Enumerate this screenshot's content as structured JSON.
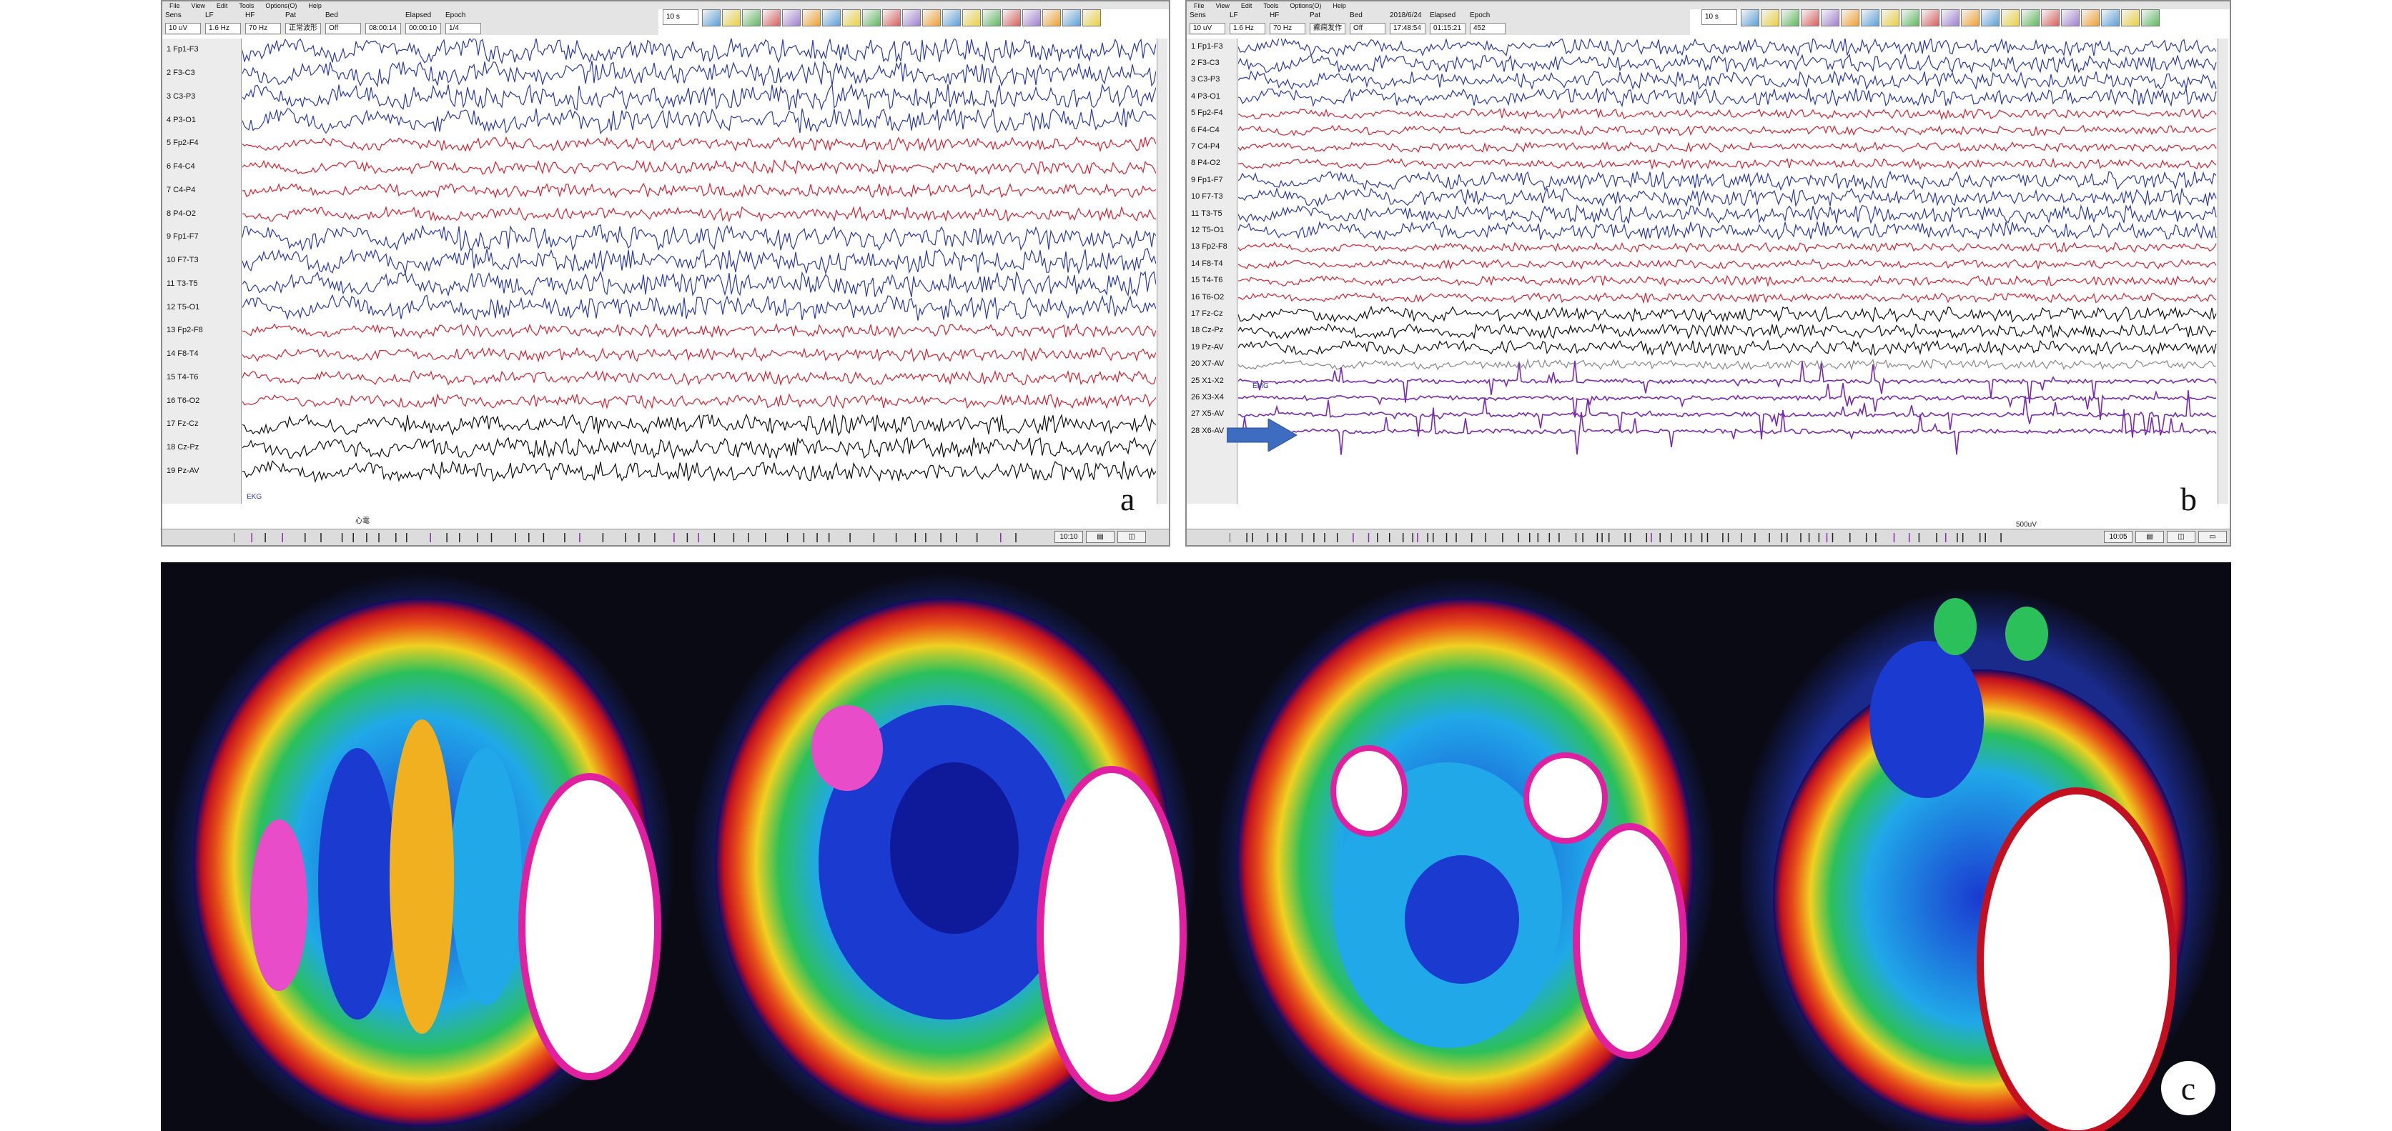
{
  "panel_a": {
    "letter": "a",
    "menu": [
      "File",
      "View",
      "Edit",
      "Tools",
      "Options(O)",
      "Help"
    ],
    "header_labels": [
      "Sens",
      "LF",
      "HF",
      "Pat",
      "Bed",
      "",
      "Elapsed",
      "Epoch"
    ],
    "fields": [
      "10 uV",
      "1.6 Hz",
      "70 Hz",
      "正常波形",
      "Off",
      "08:00:14",
      "00:00:10",
      "1/4"
    ],
    "paging": "10 s",
    "channels": [
      "1 Fp1-F3",
      "2 F3-C3",
      "3 C3-P3",
      "4 P3-O1",
      "5 Fp2-F4",
      "6 F4-C4",
      "7 C4-P4",
      "8 P4-O2",
      "9 Fp1-F7",
      "10 F7-T3",
      "11 T3-T5",
      "12 T5-O1",
      "13 Fp2-F8",
      "14 F8-T4",
      "15 T4-T6",
      "16 T6-O2",
      "17 Fz-Cz",
      "18 Cz-Pz",
      "19 Pz-AV"
    ],
    "channel_colors": [
      "blue",
      "blue",
      "blue",
      "blue",
      "red",
      "red",
      "red",
      "red",
      "blue",
      "blue",
      "blue",
      "blue",
      "red",
      "red",
      "red",
      "red",
      "black",
      "black",
      "black"
    ],
    "bottom_labels": [
      "EKG",
      "心電"
    ],
    "status_buttons": [
      "10:10",
      "▤",
      "◫"
    ]
  },
  "panel_b": {
    "letter": "b",
    "menu": [
      "File",
      "View",
      "Edit",
      "Tools",
      "Options(O)",
      "Help"
    ],
    "header_labels": [
      "Sens",
      "LF",
      "HF",
      "Pat",
      "Bed",
      "2018/6/24",
      "Elapsed",
      "Epoch"
    ],
    "fields": [
      "10 uV",
      "1.6 Hz",
      "70 Hz",
      "癫痫发作",
      "Off",
      "17:48:54",
      "01:15:21",
      "452"
    ],
    "paging": "10 s",
    "channels": [
      "1 Fp1-F3",
      "2 F3-C3",
      "3 C3-P3",
      "4 P3-O1",
      "5 Fp2-F4",
      "6 F4-C4",
      "7 C4-P4",
      "8 P4-O2",
      "9 Fp1-F7",
      "10 F7-T3",
      "11 T3-T5",
      "12 T5-O1",
      "13 Fp2-F8",
      "14 F8-T4",
      "15 T4-T6",
      "16 T6-O2",
      "17 Fz-Cz",
      "18 Cz-Pz",
      "19 Pz-AV",
      "20 X7-AV",
      "25 X1-X2",
      "26 X3-X4",
      "27 X5-AV",
      "28 X6-AV"
    ],
    "channel_colors": [
      "blue",
      "blue",
      "blue",
      "blue",
      "red",
      "red",
      "red",
      "red",
      "blue",
      "blue",
      "blue",
      "blue",
      "red",
      "red",
      "red",
      "red",
      "black",
      "black",
      "black",
      "gray",
      "purple",
      "purple",
      "purple",
      "purple"
    ],
    "emg_label": "EMG",
    "scale_label": "500uV",
    "status_buttons": [
      "10:05",
      "▤",
      "◫",
      "▭"
    ]
  },
  "panel_c": {
    "letter": "c",
    "slice_count": 4
  },
  "colors": {
    "eeg_blue": "#2a3aa8",
    "eeg_red": "#d42030",
    "eeg_black": "#111111",
    "emg_purple": "#7a2ab0",
    "arrow": "#3d6cc0"
  }
}
